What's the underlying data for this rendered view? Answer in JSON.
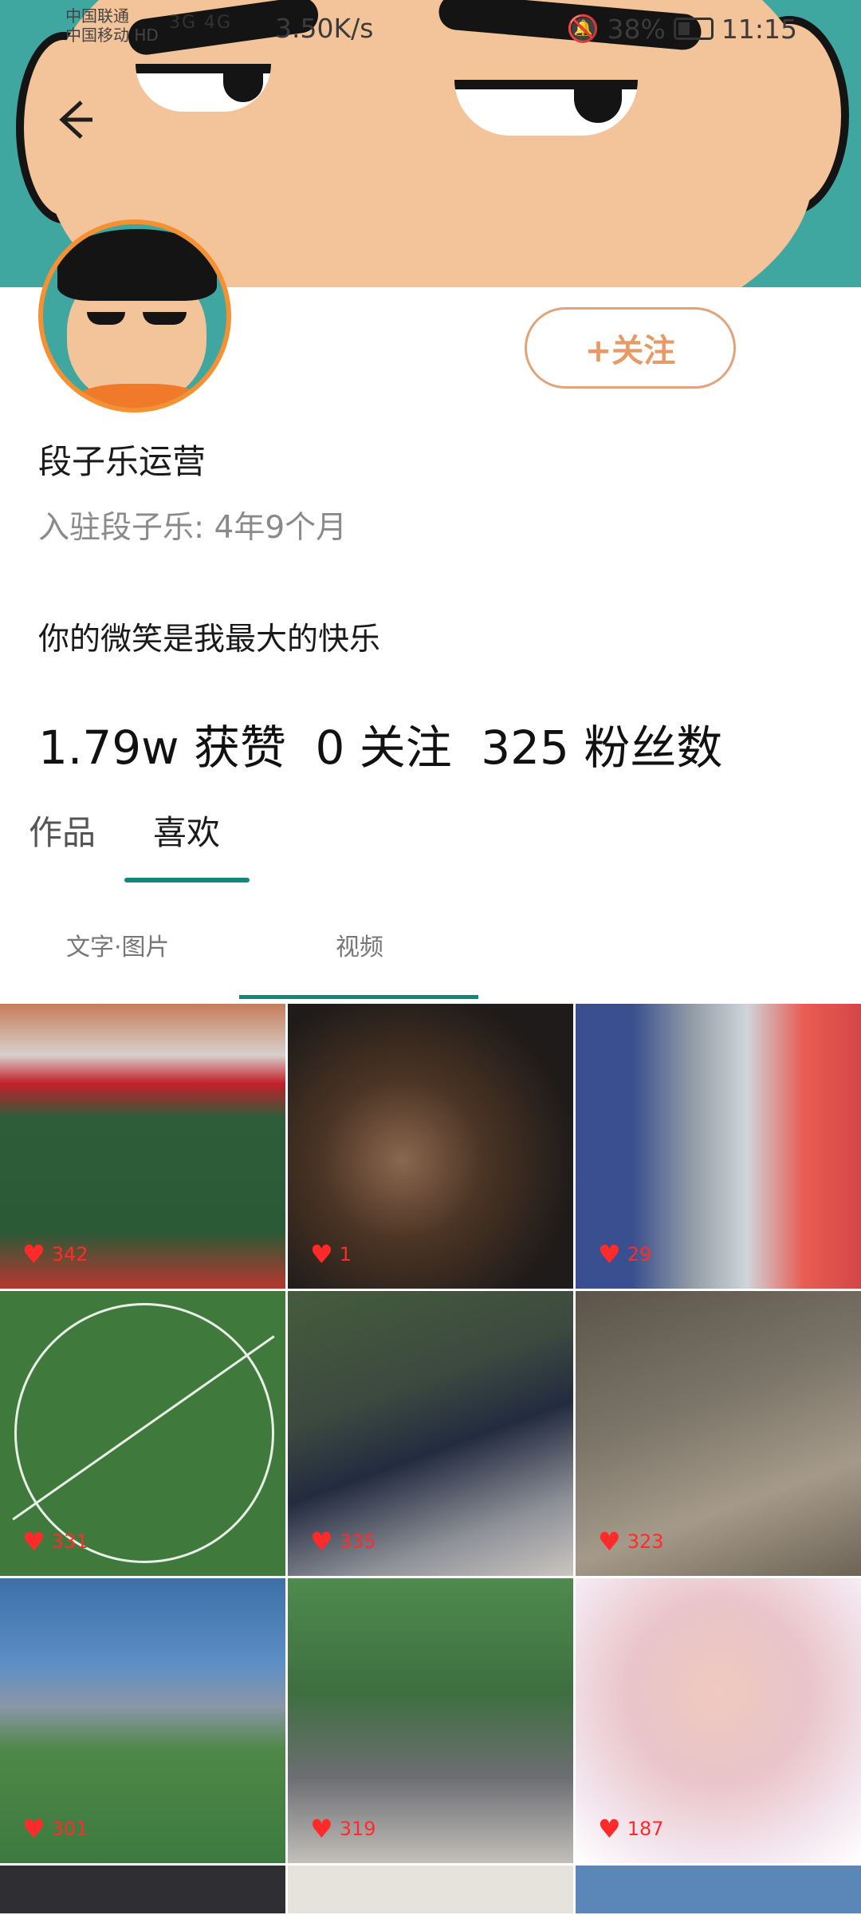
{
  "status_bar": {
    "carrier_1": "中国联通",
    "carrier_2": "中国移动 HD",
    "network": "3G 4G",
    "speed": "3.50K/s",
    "battery": "38%",
    "time": "11:15"
  },
  "profile": {
    "follow_label": "+关注",
    "username": "段子乐运营",
    "joined": "入驻段子乐: 4年9个月",
    "bio": "你的微笑是我最大的快乐",
    "stats": {
      "likes": "1.79w 获赞",
      "following": "0 关注",
      "followers": "325 粉丝数"
    }
  },
  "tabs": {
    "works": "作品",
    "likes": "喜欢"
  },
  "subtabs": {
    "text_image": "文字·图片",
    "video": "视频"
  },
  "grid": [
    {
      "likes": "342"
    },
    {
      "likes": "1"
    },
    {
      "likes": "29"
    },
    {
      "likes": "331"
    },
    {
      "likes": "335"
    },
    {
      "likes": "323"
    },
    {
      "likes": "301"
    },
    {
      "likes": "319"
    },
    {
      "likes": "187"
    }
  ],
  "colors": {
    "accent": "#12877a",
    "follow": "#e79a66",
    "heart": "#ff2b2b"
  },
  "icons": {
    "back": "arrow-left-icon",
    "heart": "heart-icon",
    "mute": "bell-off-icon"
  }
}
